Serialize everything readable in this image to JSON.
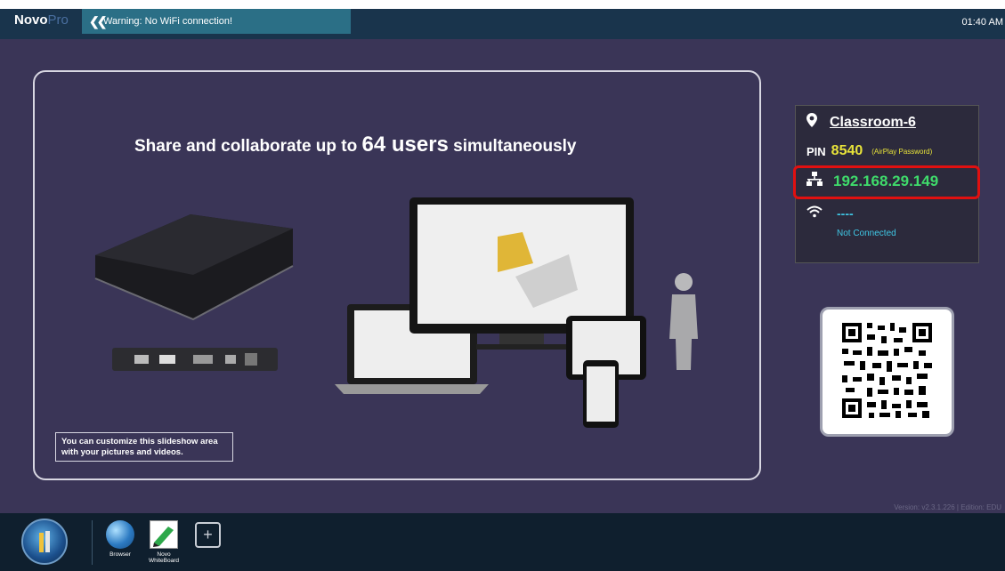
{
  "topbar": {
    "logo_a": "Novo",
    "logo_b": "Pro",
    "warning": "Warning: No WiFi connection!",
    "clock": "01:40 AM"
  },
  "slide": {
    "title_pre": "Share and collaborate up to ",
    "title_big": "64 users",
    "title_post": " simultaneously",
    "caption_line1": "You can customize this slideshow area",
    "caption_line2": "with your pictures and videos."
  },
  "info": {
    "room": "Classroom-6",
    "pin_label": "PIN",
    "pin": "8540",
    "pin_hint": "(AirPlay Password)",
    "ip": "192.168.29.149",
    "wifi": "----",
    "wifi_status": "Not Connected"
  },
  "version": "Version: v2.3.1.226 | Edition: EDU",
  "taskbar": {
    "apps": [
      {
        "label": "Browser"
      },
      {
        "label_line1": "Novo",
        "label_line2": "WhiteBoard"
      }
    ],
    "add": "+"
  },
  "colors": {
    "background": "#3a3557",
    "topbar": "#19344c",
    "warning_bg": "#2b6f86",
    "pin": "#e8e33a",
    "ip": "#3fdb6b",
    "wifi": "#3fc8e6",
    "highlight": "#e01010"
  },
  "icons": [
    "location-pin-icon",
    "network-icon",
    "wifi-icon",
    "chevron-double-left-icon",
    "start-icon",
    "browser-icon",
    "whiteboard-icon",
    "add-icon"
  ]
}
